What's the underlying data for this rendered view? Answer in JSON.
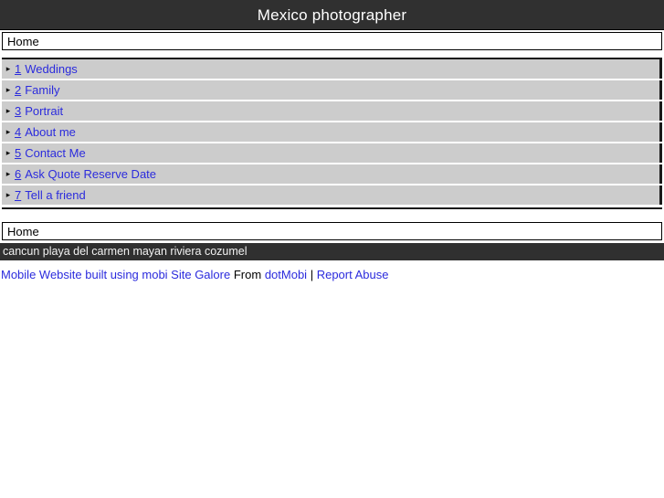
{
  "header": {
    "site_title": "Mexico photographer",
    "background_color": "#303030",
    "text_color": "#ffffff"
  },
  "top_nav": {
    "home_label": "Home"
  },
  "menu": {
    "bullet_icon": "▸",
    "link_color": "#2b2bdd",
    "item_background": "#cccccc",
    "items": [
      {
        "number": "1",
        "label": "Weddings"
      },
      {
        "number": "2",
        "label": "Family"
      },
      {
        "number": "3",
        "label": "Portrait"
      },
      {
        "number": "4",
        "label": "About me"
      },
      {
        "number": "5",
        "label": "Contact Me"
      },
      {
        "number": "6",
        "label": "Ask Quote Reserve Date"
      },
      {
        "number": "7",
        "label": "Tell a friend"
      }
    ]
  },
  "bottom_nav": {
    "home_label": "Home"
  },
  "tagline": {
    "text": "cancun playa del carmen mayan riviera cozumel",
    "background_color": "#303030",
    "text_color": "#f2f2f2"
  },
  "footer": {
    "builder_link": "Mobile Website built using mobi Site Galore",
    "from_text": "From",
    "provider_link": "dotMobi",
    "separator": "|",
    "report_link": "Report Abuse"
  }
}
